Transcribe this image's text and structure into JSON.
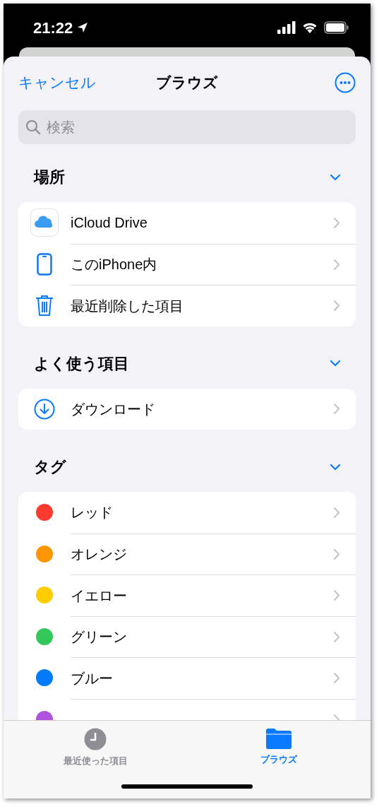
{
  "status_bar": {
    "time": "21:22"
  },
  "nav": {
    "cancel": "キャンセル",
    "title": "ブラウズ"
  },
  "search": {
    "placeholder": "検索"
  },
  "sections": [
    {
      "title": "場所",
      "expanded": true,
      "items": [
        {
          "kind": "icloud",
          "label": "iCloud Drive"
        },
        {
          "kind": "phone",
          "label": "このiPhone内"
        },
        {
          "kind": "trash",
          "label": "最近削除した項目"
        }
      ]
    },
    {
      "title": "よく使う項目",
      "expanded": true,
      "items": [
        {
          "kind": "download",
          "label": "ダウンロード"
        }
      ]
    },
    {
      "title": "タグ",
      "expanded": true,
      "items": [
        {
          "kind": "tag",
          "label": "レッド",
          "color": "#ff3b30"
        },
        {
          "kind": "tag",
          "label": "オレンジ",
          "color": "#ff9500"
        },
        {
          "kind": "tag",
          "label": "イエロー",
          "color": "#ffcc00"
        },
        {
          "kind": "tag",
          "label": "グリーン",
          "color": "#34c759"
        },
        {
          "kind": "tag",
          "label": "ブルー",
          "color": "#007aff"
        },
        {
          "kind": "tag",
          "color": "#af52de"
        }
      ]
    }
  ],
  "tab_bar": [
    {
      "kind": "recents",
      "label": "最近使った項目",
      "selected": false
    },
    {
      "kind": "browse",
      "label": "ブラウズ",
      "selected": true
    }
  ]
}
